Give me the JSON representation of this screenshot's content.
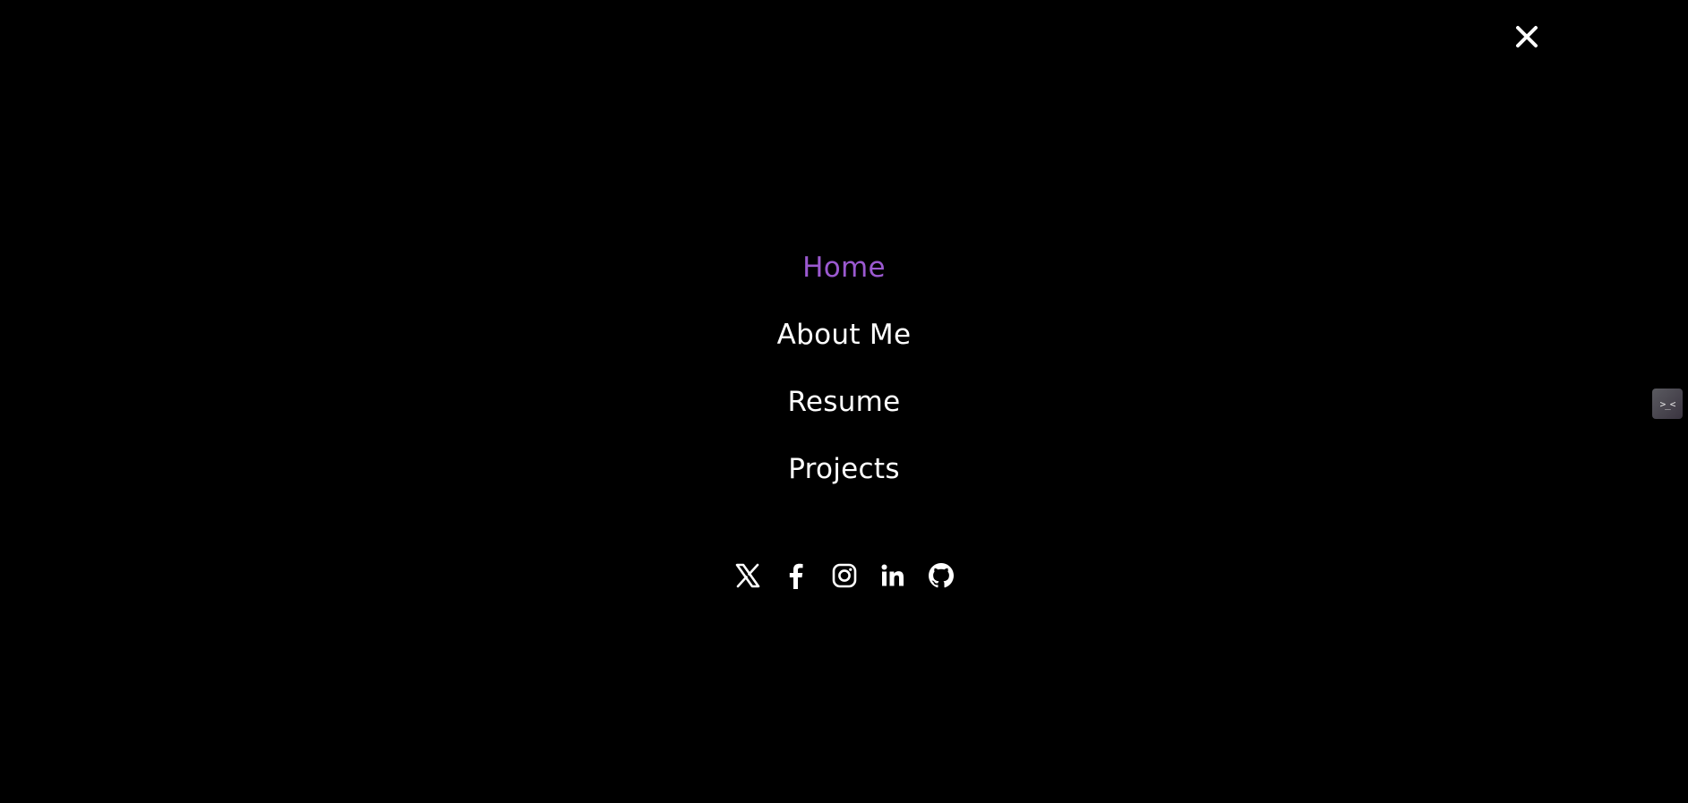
{
  "close_button": {
    "icon": "close-icon",
    "color": "#ffffff"
  },
  "nav": {
    "active_color": "#9b59d0",
    "items": [
      {
        "label": "Home",
        "active": true
      },
      {
        "label": "About Me",
        "active": false
      },
      {
        "label": "Resume",
        "active": false
      },
      {
        "label": "Projects",
        "active": false
      }
    ]
  },
  "socials": [
    {
      "icon": "x-twitter-icon"
    },
    {
      "icon": "facebook-icon"
    },
    {
      "icon": "instagram-icon"
    },
    {
      "icon": "linkedin-icon"
    },
    {
      "icon": "github-icon"
    }
  ],
  "side_tab": {
    "label": ">_<",
    "icon": "emoticon-icon"
  }
}
